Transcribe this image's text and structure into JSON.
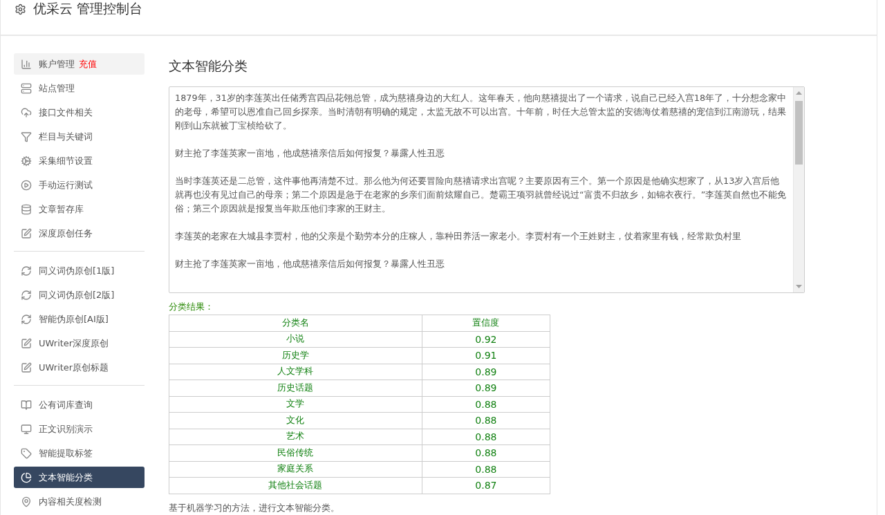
{
  "header": {
    "title": "优采云 管理控制台"
  },
  "sidebar": {
    "groups": [
      {
        "items": [
          {
            "label": "账户管理",
            "badge": "充值",
            "selected": false,
            "hover": true
          },
          {
            "label": "站点管理",
            "selected": false,
            "hover": false
          },
          {
            "label": "接口文件相关",
            "selected": false,
            "hover": false
          },
          {
            "label": "栏目与关键词",
            "selected": false,
            "hover": false
          },
          {
            "label": "采集细节设置",
            "selected": false,
            "hover": false
          },
          {
            "label": "手动运行测试",
            "selected": false,
            "hover": false
          },
          {
            "label": "文章暂存库",
            "selected": false,
            "hover": false
          },
          {
            "label": "深度原创任务",
            "selected": false,
            "hover": false
          }
        ]
      },
      {
        "items": [
          {
            "label": "同义词伪原创[1版]",
            "selected": false,
            "hover": false
          },
          {
            "label": "同义词伪原创[2版]",
            "selected": false,
            "hover": false
          },
          {
            "label": "智能伪原创[AI版]",
            "selected": false,
            "hover": false
          },
          {
            "label": "UWriter深度原创",
            "selected": false,
            "hover": false
          },
          {
            "label": "UWriter原创标题",
            "selected": false,
            "hover": false
          }
        ]
      },
      {
        "items": [
          {
            "label": "公有词库查询",
            "selected": false,
            "hover": false
          },
          {
            "label": "正文识别演示",
            "selected": false,
            "hover": false
          },
          {
            "label": "智能提取标签",
            "selected": false,
            "hover": false
          },
          {
            "label": "文本智能分类",
            "selected": true,
            "hover": false
          },
          {
            "label": "内容相关度检测",
            "selected": false,
            "hover": false
          }
        ]
      }
    ]
  },
  "main": {
    "title": "文本智能分类",
    "text_input": {
      "value": [
        "1879年，31岁的李莲英出任储秀宫四品花翎总管，成为慈禧身边的大红人。这年春天，他向慈禧提出了一个请求，说自己已经入宫18年了，十分想念家中的老母，希望可以恩准自己回乡探亲。当时清朝有明确的规定，太监无故不可以出宫。十年前，时任大总管太监的安德海仗着慈禧的宠信到江南游玩，结果刚到山东就被丁宝桢给砍了。",
        "财主抢了李莲英家一亩地，他成慈禧亲信后如何报复？暴露人性丑恶",
        "当时李莲英还是二总管，这件事他再清楚不过。那么他为何还要冒险向慈禧请求出宫呢？主要原因有三个。第一个原因是他确实想家了，从13岁入宫后他就再也没有见过自己的母亲；第二个原因是急于在老家的乡亲们面前炫耀自己。楚霸王项羽就曾经说过“富贵不归故乡，如锦衣夜行。”李莲英自然也不能免俗；第三个原因就是报复当年欺压他们李家的王财主。",
        "李莲英的老家在大城县李贾村，他的父亲是个勤劳本分的庄稼人，靠种田养活一家老小。李贾村有一个王姓财主，仗着家里有钱，经常欺负村里",
        "财主抢了李莲英家一亩地，他成慈禧亲信后如何报复？暴露人性丑恶"
      ]
    },
    "result_label": "分类结果：",
    "table": {
      "columns": [
        "分类名",
        "置信度"
      ],
      "rows": [
        [
          "小说",
          "0.92"
        ],
        [
          "历史学",
          "0.91"
        ],
        [
          "人文学科",
          "0.89"
        ],
        [
          "历史话题",
          "0.89"
        ],
        [
          "文学",
          "0.88"
        ],
        [
          "文化",
          "0.88"
        ],
        [
          "艺术",
          "0.88"
        ],
        [
          "民俗传统",
          "0.88"
        ],
        [
          "家庭关系",
          "0.88"
        ],
        [
          "其他社会话题",
          "0.87"
        ]
      ]
    },
    "footnote": "基于机器学习的方法，进行文本智能分类。"
  }
}
